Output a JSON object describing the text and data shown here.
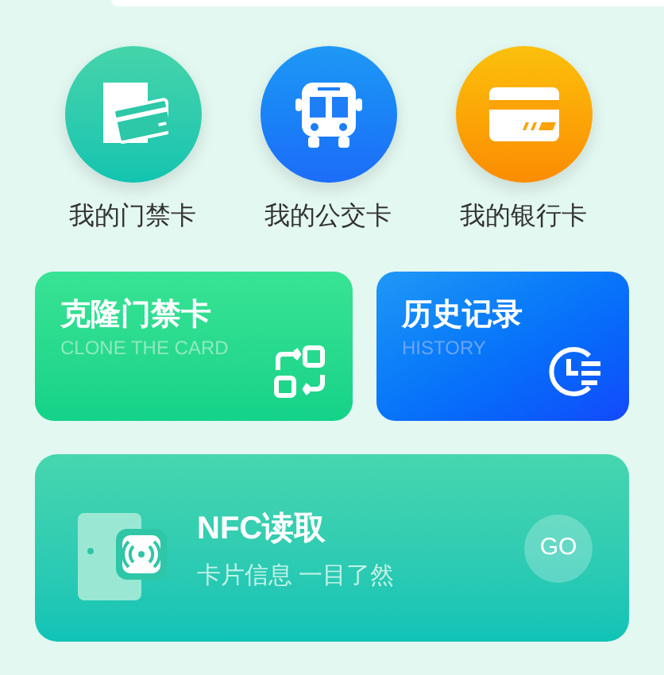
{
  "shortcuts": [
    {
      "kind": "access",
      "label": "我的门禁卡"
    },
    {
      "kind": "bus",
      "label": "我的公交卡"
    },
    {
      "kind": "bank",
      "label": "我的银行卡"
    }
  ],
  "cards": [
    {
      "kind": "clone",
      "title": "克隆门禁卡",
      "subtitle": "CLONE THE CARD"
    },
    {
      "kind": "history",
      "title": "历史记录",
      "subtitle": "HISTORY"
    }
  ],
  "nfc": {
    "title": "NFC读取",
    "subtitle": "卡片信息 一目了然",
    "button": "GO"
  }
}
